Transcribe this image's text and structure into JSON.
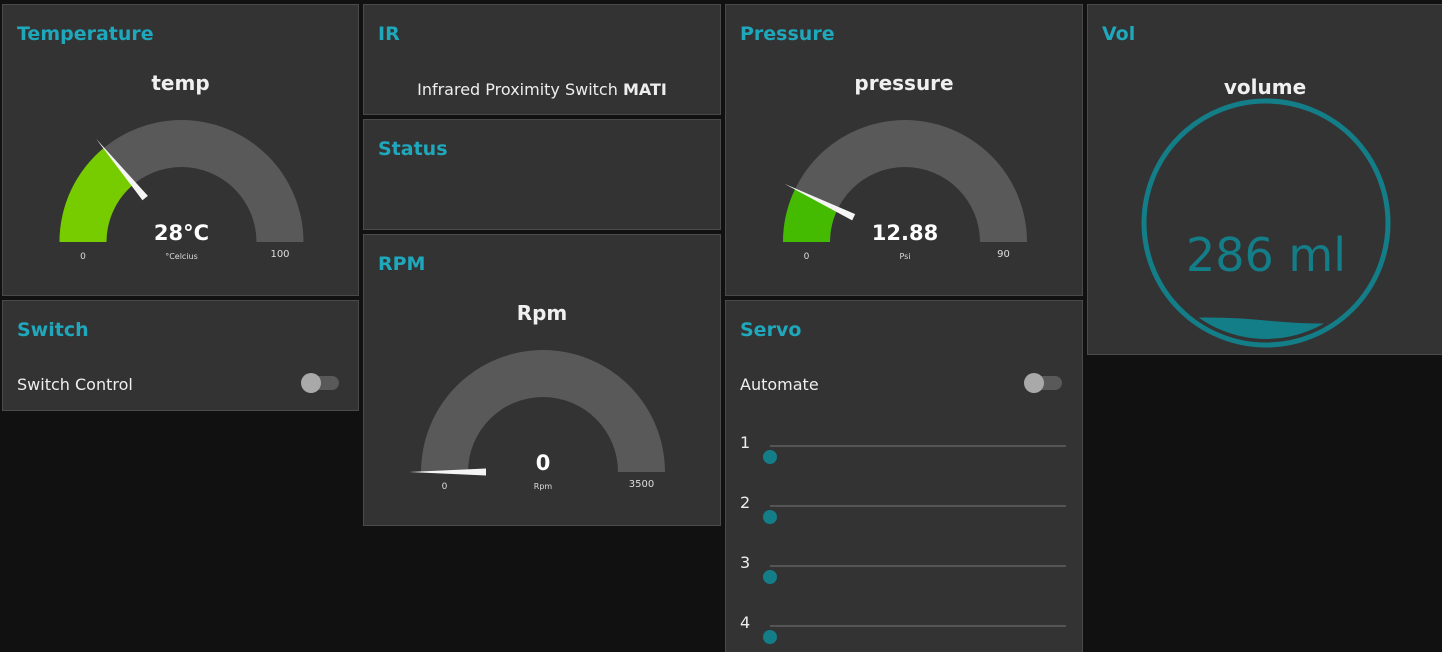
{
  "colors": {
    "accent": "#1fa7bc",
    "temp_fill": "#77cc00",
    "pressure_fill": "#44bb00",
    "gauge_bg": "#595959",
    "volume": "#137d88"
  },
  "temperature": {
    "title": "Temperature",
    "label": "temp",
    "value": 28,
    "value_text": "28°C",
    "units": "°Celcius",
    "min": 0,
    "max": 100,
    "min_text": "0",
    "max_text": "100"
  },
  "switch": {
    "title": "Switch",
    "control_label": "Switch Control",
    "state": "off"
  },
  "ir": {
    "title": "IR",
    "text": "Infrared Proximity Switch",
    "bold_text": "MATI"
  },
  "status": {
    "title": "Status"
  },
  "rpm": {
    "title": "RPM",
    "label": "Rpm",
    "value": 0,
    "value_text": "0",
    "units": "Rpm",
    "min": 0,
    "max": 3500,
    "min_text": "0",
    "max_text": "3500"
  },
  "pressure": {
    "title": "Pressure",
    "label": "pressure",
    "value": 12.88,
    "value_text": "12.88",
    "units": "Psi",
    "min": 0,
    "max": 90,
    "min_text": "0",
    "max_text": "90"
  },
  "servo": {
    "title": "Servo",
    "automate_label": "Automate",
    "automate_state": "off",
    "sliders": [
      {
        "label": "1",
        "value": 0
      },
      {
        "label": "2",
        "value": 0
      },
      {
        "label": "3",
        "value": 0
      },
      {
        "label": "4",
        "value": 0
      }
    ]
  },
  "vol": {
    "title": "Vol",
    "label": "volume",
    "value_text": "286 ml",
    "fill_fraction": 0.08
  }
}
